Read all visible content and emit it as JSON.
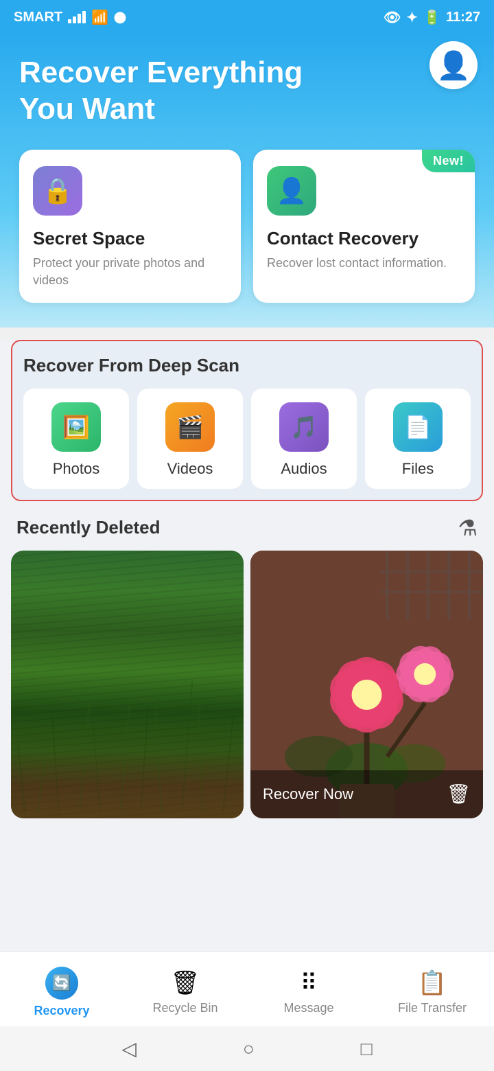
{
  "statusBar": {
    "carrier": "SMART",
    "time": "11:27",
    "batteryLevel": "52"
  },
  "header": {
    "heroTitle": "Recover Everything You Want",
    "avatarLabel": "user-avatar"
  },
  "featureCards": [
    {
      "id": "secret-space",
      "title": "Secret Space",
      "description": "Protect your private photos and videos",
      "iconType": "purple",
      "isNew": false
    },
    {
      "id": "contact-recovery",
      "title": "Contact Recovery",
      "description": "Recover lost contact information.",
      "iconType": "green",
      "isNew": true,
      "newLabel": "New!"
    }
  ],
  "deepScan": {
    "sectionTitle": "Recover From Deep Scan",
    "items": [
      {
        "id": "photos",
        "label": "Photos",
        "iconType": "photos"
      },
      {
        "id": "videos",
        "label": "Videos",
        "iconType": "videos"
      },
      {
        "id": "audios",
        "label": "Audios",
        "iconType": "audios"
      },
      {
        "id": "files",
        "label": "Files",
        "iconType": "files"
      }
    ]
  },
  "recentlyDeleted": {
    "sectionTitle": "Recently Deleted",
    "filterLabel": "filter"
  },
  "photos": [
    {
      "id": "grass-photo",
      "type": "grass",
      "hasOverlay": false
    },
    {
      "id": "flower-photo",
      "type": "flower",
      "hasOverlay": true,
      "overlayText": "Recover Now"
    }
  ],
  "bottomNav": {
    "items": [
      {
        "id": "recovery",
        "label": "Recovery",
        "active": true
      },
      {
        "id": "recycle-bin",
        "label": "Recycle Bin",
        "active": false
      },
      {
        "id": "message",
        "label": "Message",
        "active": false
      },
      {
        "id": "file-transfer",
        "label": "File Transfer",
        "active": false
      }
    ]
  },
  "systemNav": {
    "back": "◁",
    "home": "○",
    "recent": "□"
  }
}
